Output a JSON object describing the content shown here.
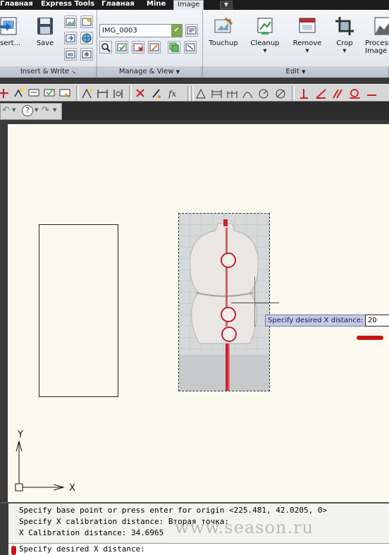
{
  "ribbon": {
    "tabs": [
      "Главная",
      "Express Tools",
      "Главная",
      "Mine",
      "Image"
    ],
    "active_tab": "Image",
    "tab_extra_icon": "dropdown-icon",
    "panels": {
      "insert_write": {
        "title": "Insert & Write",
        "buttons": [
          "Insert...",
          "Save"
        ]
      },
      "manage_view": {
        "title": "Manage & View",
        "image_combo_value": "IMG_0003"
      },
      "edit": {
        "title": "Edit",
        "buttons": [
          {
            "label": "Touchup",
            "dropdown": false
          },
          {
            "label": "Cleanup",
            "dropdown": true
          },
          {
            "label": "Remove",
            "dropdown": true
          },
          {
            "label": "Crop",
            "dropdown": true
          },
          {
            "label": "Process Image",
            "dropdown": false
          }
        ]
      }
    }
  },
  "canvas": {
    "background": "#fcfaef",
    "tooltip_label": "Specify desired X distance:",
    "tooltip_input_value": "20",
    "ucs_x_label": "X",
    "ucs_y_label": "Y",
    "highlight_color": "#c8121a"
  },
  "command_line": {
    "history": [
      "Specify base point or press enter for origin <225.481, 42.0205, 0>",
      "Specify X calibration distance:  Вторая точка:",
      "X Calibration distance: 34.6965"
    ],
    "prompt": "Specify desired X distance:",
    "watermark": "www.season.ru"
  }
}
